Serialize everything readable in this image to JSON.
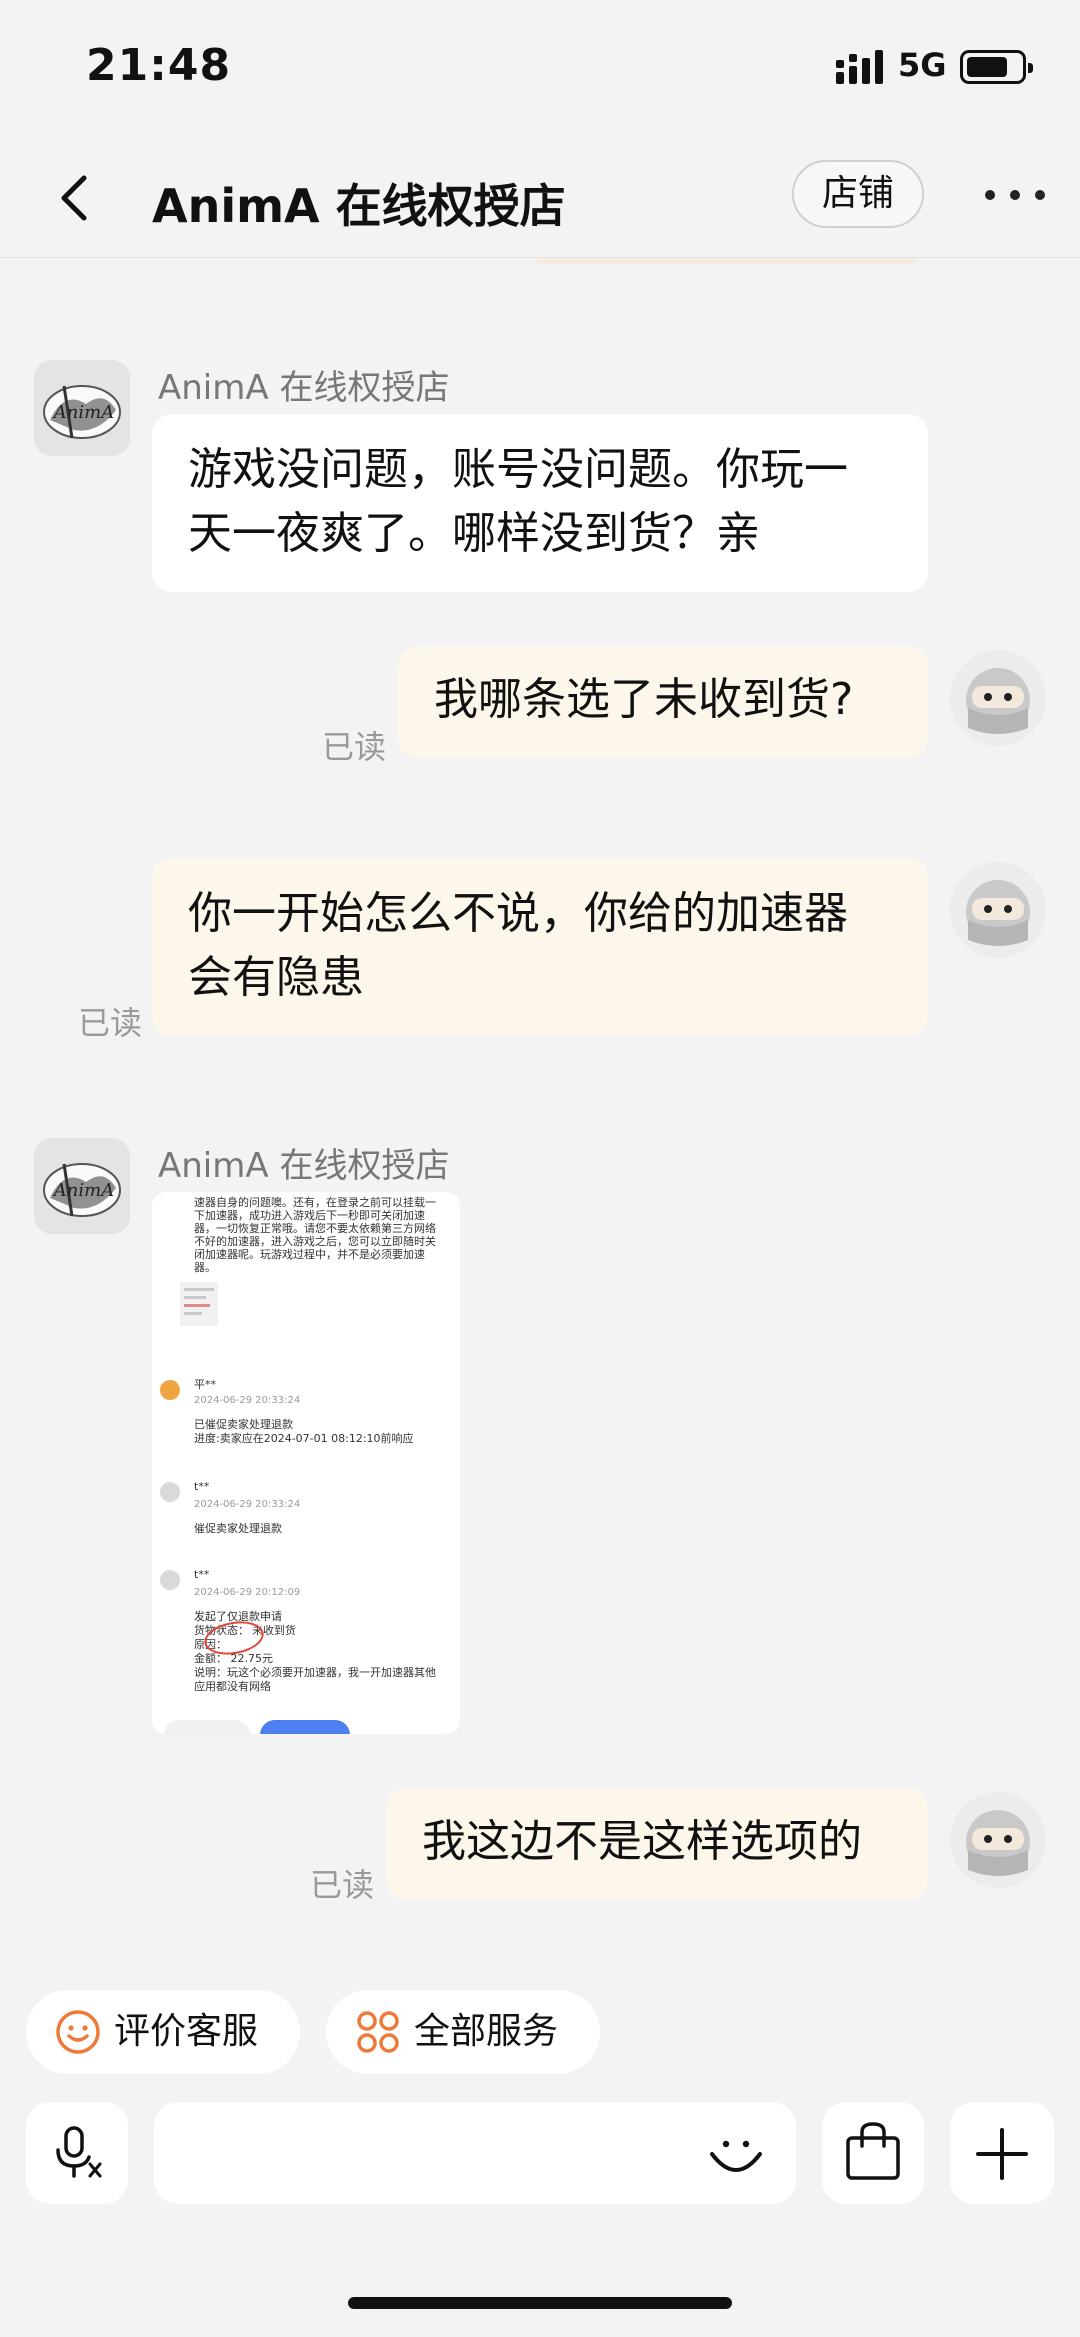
{
  "status_bar": {
    "time": "21:48",
    "network": "5G"
  },
  "header": {
    "title": "AnimA 在线权授店",
    "shop_label": "店铺"
  },
  "messages": {
    "m1": {
      "sender": "AnimA 在线权授店",
      "line1": "游戏没问题，账号没问题。你玩一",
      "line2": "天一夜爽了。哪样没到货？亲",
      "avatar_text": "AnimA"
    },
    "m2": {
      "text": "我哪条选了未收到货?",
      "read": "已读"
    },
    "m3": {
      "line1": "你一开始怎么不说，你给的加速器",
      "line2": "会有隐患",
      "read": "已读"
    },
    "m4": {
      "sender": "AnimA 在线权授店",
      "avatar_text": "AnimA"
    },
    "m5": {
      "text": "我这边不是这样选项的",
      "read": "已读"
    }
  },
  "screenshot": {
    "para": [
      "速器自身的问题噢。还有，在登录之前可以挂载一",
      "下加速器，成功进入游戏后下一秒即可关闭加速",
      "器，一切恢复正常哦。请您不要太依赖第三方网络",
      "不好的加速器，进入游戏之后，您可以立即随时关",
      "闭加速器呢。玩游戏过程中，并不是必须要加速",
      "器。"
    ],
    "e1": {
      "name": "平**",
      "time": "2024-06-29 20:33:24",
      "l1": "已催促卖家处理退款",
      "l2": "进度:卖家应在2024-07-01 08:12:10前响应"
    },
    "e2": {
      "name": "t**",
      "time": "2024-06-29 20:33:24",
      "l1": "催促卖家处理退款"
    },
    "e3": {
      "name": "t**",
      "time": "2024-06-29 20:12:09",
      "l1": "发起了仅退款申请",
      "l2_label": "货物状态：",
      "l2_value": "未收到货",
      "l3": "原因：",
      "l4": "金额： 22.75元",
      "l5": "说明：玩这个必须要开加速器，我一开加速器其他",
      "l6": "应用都没有网络"
    }
  },
  "quick_actions": {
    "rate": "评价客服",
    "services": "全部服务"
  },
  "input_bar": {
    "placeholder": ""
  },
  "colors": {
    "accent_orange": "#ee7a3a",
    "bubble_cream": "#fcf7ea",
    "bubble_white": "#ffffff",
    "background": "#f3f3f3"
  }
}
